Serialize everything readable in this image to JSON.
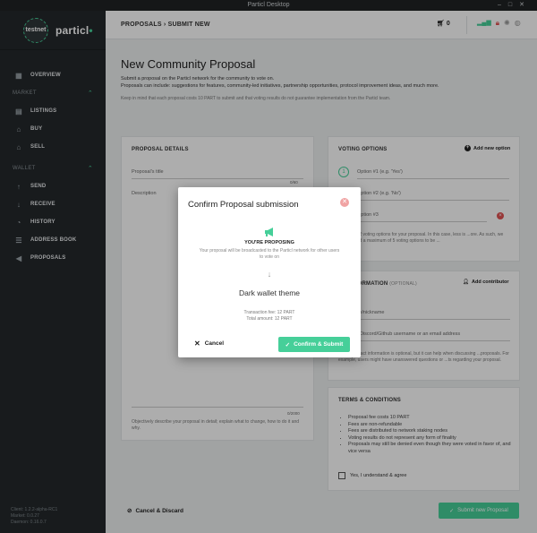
{
  "window": {
    "title": "Particl Desktop",
    "controls": [
      "–",
      "□",
      "✕"
    ]
  },
  "brand": {
    "badge": "testnet",
    "name": "particl"
  },
  "sidebar": {
    "top_items": [
      {
        "label": "OVERVIEW",
        "icon": "dashboard-icon"
      }
    ],
    "market_label": "MARKET",
    "market_items": [
      {
        "label": "LISTINGS",
        "icon": "listings-icon"
      },
      {
        "label": "BUY",
        "icon": "buy-icon"
      },
      {
        "label": "SELL",
        "icon": "sell-icon"
      }
    ],
    "wallet_label": "WALLET",
    "wallet_items": [
      {
        "label": "SEND",
        "icon": "send-icon"
      },
      {
        "label": "RECEIVE",
        "icon": "receive-icon"
      },
      {
        "label": "HISTORY",
        "icon": "history-icon"
      },
      {
        "label": "ADDRESS BOOK",
        "icon": "address-book-icon"
      },
      {
        "label": "PROPOSALS",
        "icon": "megaphone-icon"
      }
    ],
    "version": {
      "client": "Client: 1.2.2-alpha-RC1",
      "market": "Market: 0.0.27",
      "daemon": "Daemon: 0.16.0.7"
    }
  },
  "topbar": {
    "breadcrumb": "PROPOSALS › SUBMIT NEW",
    "cart_count": "0"
  },
  "page": {
    "title": "New Community Proposal",
    "desc1": "Submit a proposal on the Particl network for the community to vote on.",
    "desc2": "Proposals can include: suggestions for features, community-led initiatives, partnership opportunities, protocol improvement ideas, and much more.",
    "note": "Keep in mind that each proposal costs 10 PART to submit and that voting results do not guarantee implementation from the Particl team."
  },
  "details": {
    "title": "PROPOSAL DETAILS",
    "title_placeholder": "Proposal's title",
    "title_count": "0/60",
    "description_label": "Description",
    "desc_count": "0/2000",
    "hint": "Objectively describe your proposal in detail; explain what to change, how to do it and why."
  },
  "voting": {
    "title": "VOTING OPTIONS",
    "add_label": "Add new option",
    "options": [
      "Option #1 (e.g. 'Yes')",
      "Option #2 (e.g. 'No')",
      "Option #3"
    ],
    "note": "...imum of 2 voting options for your proposal. In this case, less is ...ore. As such, we recommend a maximum of 5 voting options to be ..."
  },
  "contact": {
    "title": "...T INFORMATION",
    "optional": "(OPTIONAL)",
    "add_label": "Add contributor",
    "name_placeholder": "Your name/nickname",
    "handle_placeholder": "Your Riot/Discord/Github username or an email address",
    "note": "...your contact information is optional, but it can help when discussing ...proposals. For example, users might have unanswered questions or ...ts regarding your proposal."
  },
  "terms": {
    "title": "TERMS & CONDITIONS",
    "items": [
      "Proposal fee costs 10 PART",
      "Fees are non-refundable",
      "Fees are distributed to network staking nodes",
      "Voting results do not represent any form of finality",
      "Proposals may still be denied even though they were voted in favor of, and vice versa"
    ],
    "agree_label": "Yes, I understand & agree"
  },
  "footer": {
    "cancel_label": "Cancel & Discard",
    "submit_label": "Submit new Proposal"
  },
  "modal": {
    "title": "Confirm Proposal submission",
    "heading": "YOU'RE PROPOSING",
    "subtext": "Your proposal will be broadcasted to the Particl network for other users to vote on",
    "proposal_name": "Dark wallet theme",
    "fee_line": "Transaction fee:  12 PART",
    "total_line": "Total amount:  12 PART",
    "cancel_label": "Cancel",
    "confirm_label": "Confirm & Submit"
  },
  "colors": {
    "accent": "#46cf99",
    "sidebar": "#24292c",
    "danger": "#e05252"
  }
}
